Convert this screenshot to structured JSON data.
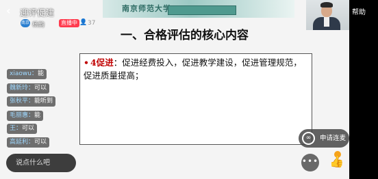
{
  "header": {
    "back_icon": "chevron-left-icon",
    "room_title": "迎评促建",
    "host_avatar_text": "南京",
    "host_name": "杨韵",
    "live_badge": "直播中",
    "viewer_icon": "person-icon",
    "viewer_count": "37",
    "help_label": "帮助"
  },
  "slide": {
    "banner_text": "南京师范大学",
    "title": "一、合格评估的核心内容",
    "bullet_key": "4促进",
    "bullet_text": "：促进经费投入，促进教学建设，促进管理规范，促进质量提高；"
  },
  "chat": [
    {
      "user": "xiaowu",
      "text": "能"
    },
    {
      "user": "魏新玲",
      "text": "可以"
    },
    {
      "user": "张秋平",
      "text": "能听到"
    },
    {
      "user": "毛丽惠",
      "text": "能"
    },
    {
      "user": "王",
      "text": "可以"
    },
    {
      "user": "高延利",
      "text": "可以"
    }
  ],
  "controls": {
    "comment_placeholder": "说点什么吧",
    "apply_label": "申请连麦",
    "apply_icon": "link-icon",
    "more_icon": "more-dots-icon",
    "like_icon": "thumbs-up-icon"
  },
  "colors": {
    "live_badge": "#ff3b4e",
    "bullet_accent": "#c00000",
    "like": "#f6a21a"
  }
}
